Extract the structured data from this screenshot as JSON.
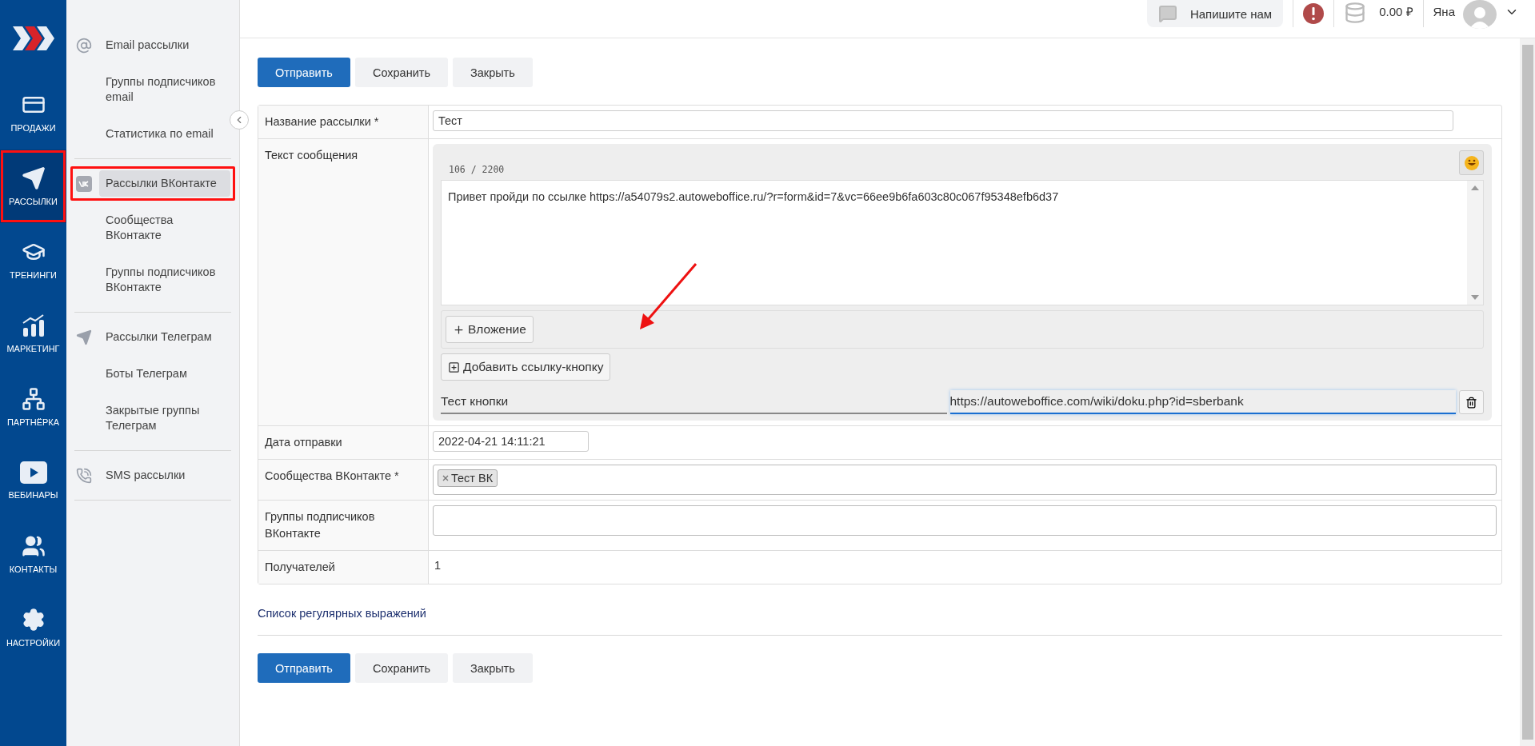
{
  "nav": [
    {
      "label": "ПРОДАЖИ",
      "kind": "sales",
      "selected": false,
      "highlighted": false
    },
    {
      "label": "РАССЫЛКИ",
      "kind": "mailings",
      "selected": true,
      "highlighted": true
    },
    {
      "label": "ТРЕНИНГИ",
      "kind": "trainings",
      "selected": false,
      "highlighted": false
    },
    {
      "label": "МАРКЕТИНГ",
      "kind": "marketing",
      "selected": false,
      "highlighted": false
    },
    {
      "label": "ПАРТНЁРКА",
      "kind": "partners",
      "selected": false,
      "highlighted": false
    },
    {
      "label": "ВЕБИНАРЫ",
      "kind": "webinars",
      "selected": false,
      "highlighted": false
    },
    {
      "label": "КОНТАКТЫ",
      "kind": "contacts",
      "selected": false,
      "highlighted": false
    },
    {
      "label": "НАСТРОЙКИ",
      "kind": "settings",
      "selected": false,
      "highlighted": false
    }
  ],
  "submenu": [
    {
      "items": [
        {
          "label": "Email рассылки",
          "kind": "email",
          "selected": false,
          "highlighted": false
        },
        {
          "label": "Группы подписчиков email",
          "kind": "plain",
          "selected": false,
          "highlighted": false
        },
        {
          "label": "Статистика по email",
          "kind": "plain",
          "selected": false,
          "highlighted": false
        }
      ]
    },
    {
      "items": [
        {
          "label": "Рассылки ВКонтакте",
          "kind": "vk",
          "selected": true,
          "highlighted": true
        },
        {
          "label": "Сообщества ВКонтакте",
          "kind": "plain",
          "selected": false,
          "highlighted": false
        },
        {
          "label": "Группы подписчиков ВКонтакте",
          "kind": "plain",
          "selected": false,
          "highlighted": false
        }
      ]
    },
    {
      "items": [
        {
          "label": "Рассылки Телеграм",
          "kind": "telegram",
          "selected": false,
          "highlighted": false
        },
        {
          "label": "Боты Телеграм",
          "kind": "plain",
          "selected": false,
          "highlighted": false
        },
        {
          "label": "Закрытые группы Телеграм",
          "kind": "plain",
          "selected": false,
          "highlighted": false
        }
      ]
    },
    {
      "items": [
        {
          "label": "SMS рассылки",
          "kind": "sms",
          "selected": false,
          "highlighted": false
        }
      ]
    }
  ],
  "topbar": {
    "contact_button": "Напишите нам",
    "balance": "0.00 ₽",
    "user": "Яна"
  },
  "top_actions": [
    {
      "label": "Отправить",
      "primary": true
    },
    {
      "label": "Сохранить",
      "primary": false
    },
    {
      "label": "Закрыть",
      "primary": false
    }
  ],
  "form": {
    "rows": [
      {
        "label": "Название рассылки *",
        "kind": "text",
        "value": "Тест"
      },
      {
        "label": "Текст сообщения",
        "kind": "message",
        "counter": "106 / 2200",
        "text": "Привет пройди по ссылке https://a54079s2.autoweboffice.ru/?r=form&id=7&vc=66ee9b6fa603c80c067f95348efb6d37",
        "attach_button": "Вложение",
        "add_link_button": "Добавить ссылку-кнопку",
        "link_text": "Тест кнопки",
        "link_url": "https://autoweboffice.com/wiki/doku.php?id=sberbank"
      },
      {
        "label": "Дата отправки",
        "kind": "date",
        "value": "2022-04-21 14:11:21"
      },
      {
        "label": "Сообщества ВКонтакте *",
        "kind": "tags",
        "tags": [
          "Тест ВК"
        ]
      },
      {
        "label": "Группы подписчиков ВКонтакте",
        "kind": "tags",
        "tags": []
      },
      {
        "label": "Получателей",
        "kind": "static",
        "value": "1"
      }
    ]
  },
  "regex_link": "Список регулярных выражений",
  "bottom_actions": [
    {
      "label": "Отправить",
      "primary": true
    },
    {
      "label": "Сохранить",
      "primary": false
    },
    {
      "label": "Закрыть",
      "primary": false
    }
  ]
}
